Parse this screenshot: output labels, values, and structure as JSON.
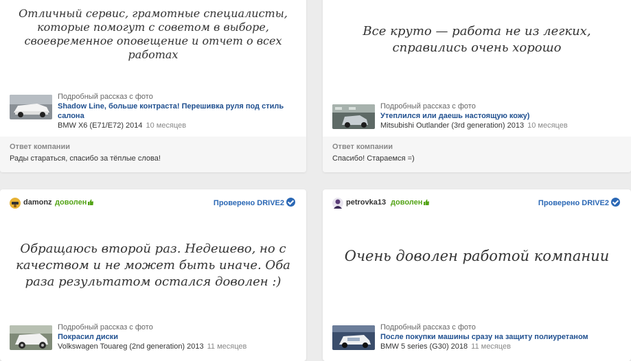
{
  "reviews": [
    {
      "quote": "Отличный сервис, грамотные специалисты, которые помогут с советом в выборе, своевременное оповещение и отчет о всех работах",
      "story": {
        "caption": "Подробный рассказ с фото",
        "title": "Shadow Line, больше контраста! Перешивка руля под стиль салона",
        "car": "BMW X6 (E71/E72) 2014",
        "time": "10 месяцев"
      },
      "reply": {
        "title": "Ответ компании",
        "text": "Рады стараться, спасибо за тёплые слова!"
      }
    },
    {
      "quote": "Все круто — работа не из легких, справились очень хорошо",
      "story": {
        "caption": "Подробный рассказ с фото",
        "title": "Утеплился или даешь настоящую кожу)",
        "car": "Mitsubishi Outlander (3rd generation) 2013",
        "time": "10 месяцев"
      },
      "reply": {
        "title": "Ответ компании",
        "text": "Спасибо! Стараемся =)"
      }
    },
    {
      "user": "damonz",
      "verdict": "доволен",
      "verified": "Проверено DRIVE2",
      "quote": "Обращаюсь второй раз. Недешево, но с качеством и не может быть иначе. Оба раза результатом остался доволен :)",
      "story": {
        "caption": "Подробный рассказ с фото",
        "title": "Покрасил диски",
        "car": "Volkswagen Touareg (2nd generation) 2013",
        "time": "11 месяцев"
      }
    },
    {
      "user": "petrovka13",
      "verdict": "доволен",
      "verified": "Проверено DRIVE2",
      "quote": "Очень доволен работой компании",
      "story": {
        "caption": "Подробный рассказ с фото",
        "title": "После покупки машины сразу на защиту полиуретаном",
        "car": "BMW 5 series (G30) 2018",
        "time": "11 месяцев"
      }
    }
  ],
  "colors": {
    "link": "#1f4f8f",
    "positive": "#53a316",
    "verified": "#2b68b5",
    "background": "#ececec"
  }
}
